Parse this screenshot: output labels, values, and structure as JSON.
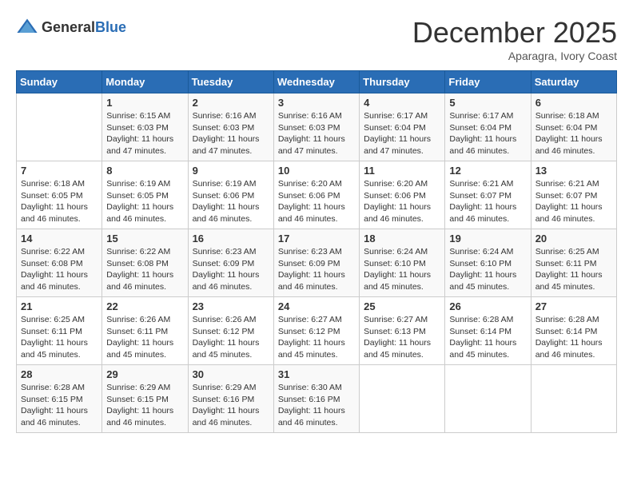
{
  "header": {
    "logo_general": "General",
    "logo_blue": "Blue",
    "title": "December 2025",
    "subtitle": "Aparagra, Ivory Coast"
  },
  "days_of_week": [
    "Sunday",
    "Monday",
    "Tuesday",
    "Wednesday",
    "Thursday",
    "Friday",
    "Saturday"
  ],
  "weeks": [
    [
      {
        "day": "",
        "sunrise": "",
        "sunset": "",
        "daylight": ""
      },
      {
        "day": "1",
        "sunrise": "Sunrise: 6:15 AM",
        "sunset": "Sunset: 6:03 PM",
        "daylight": "Daylight: 11 hours and 47 minutes."
      },
      {
        "day": "2",
        "sunrise": "Sunrise: 6:16 AM",
        "sunset": "Sunset: 6:03 PM",
        "daylight": "Daylight: 11 hours and 47 minutes."
      },
      {
        "day": "3",
        "sunrise": "Sunrise: 6:16 AM",
        "sunset": "Sunset: 6:03 PM",
        "daylight": "Daylight: 11 hours and 47 minutes."
      },
      {
        "day": "4",
        "sunrise": "Sunrise: 6:17 AM",
        "sunset": "Sunset: 6:04 PM",
        "daylight": "Daylight: 11 hours and 47 minutes."
      },
      {
        "day": "5",
        "sunrise": "Sunrise: 6:17 AM",
        "sunset": "Sunset: 6:04 PM",
        "daylight": "Daylight: 11 hours and 46 minutes."
      },
      {
        "day": "6",
        "sunrise": "Sunrise: 6:18 AM",
        "sunset": "Sunset: 6:04 PM",
        "daylight": "Daylight: 11 hours and 46 minutes."
      }
    ],
    [
      {
        "day": "7",
        "sunrise": "Sunrise: 6:18 AM",
        "sunset": "Sunset: 6:05 PM",
        "daylight": "Daylight: 11 hours and 46 minutes."
      },
      {
        "day": "8",
        "sunrise": "Sunrise: 6:19 AM",
        "sunset": "Sunset: 6:05 PM",
        "daylight": "Daylight: 11 hours and 46 minutes."
      },
      {
        "day": "9",
        "sunrise": "Sunrise: 6:19 AM",
        "sunset": "Sunset: 6:06 PM",
        "daylight": "Daylight: 11 hours and 46 minutes."
      },
      {
        "day": "10",
        "sunrise": "Sunrise: 6:20 AM",
        "sunset": "Sunset: 6:06 PM",
        "daylight": "Daylight: 11 hours and 46 minutes."
      },
      {
        "day": "11",
        "sunrise": "Sunrise: 6:20 AM",
        "sunset": "Sunset: 6:06 PM",
        "daylight": "Daylight: 11 hours and 46 minutes."
      },
      {
        "day": "12",
        "sunrise": "Sunrise: 6:21 AM",
        "sunset": "Sunset: 6:07 PM",
        "daylight": "Daylight: 11 hours and 46 minutes."
      },
      {
        "day": "13",
        "sunrise": "Sunrise: 6:21 AM",
        "sunset": "Sunset: 6:07 PM",
        "daylight": "Daylight: 11 hours and 46 minutes."
      }
    ],
    [
      {
        "day": "14",
        "sunrise": "Sunrise: 6:22 AM",
        "sunset": "Sunset: 6:08 PM",
        "daylight": "Daylight: 11 hours and 46 minutes."
      },
      {
        "day": "15",
        "sunrise": "Sunrise: 6:22 AM",
        "sunset": "Sunset: 6:08 PM",
        "daylight": "Daylight: 11 hours and 46 minutes."
      },
      {
        "day": "16",
        "sunrise": "Sunrise: 6:23 AM",
        "sunset": "Sunset: 6:09 PM",
        "daylight": "Daylight: 11 hours and 46 minutes."
      },
      {
        "day": "17",
        "sunrise": "Sunrise: 6:23 AM",
        "sunset": "Sunset: 6:09 PM",
        "daylight": "Daylight: 11 hours and 46 minutes."
      },
      {
        "day": "18",
        "sunrise": "Sunrise: 6:24 AM",
        "sunset": "Sunset: 6:10 PM",
        "daylight": "Daylight: 11 hours and 45 minutes."
      },
      {
        "day": "19",
        "sunrise": "Sunrise: 6:24 AM",
        "sunset": "Sunset: 6:10 PM",
        "daylight": "Daylight: 11 hours and 45 minutes."
      },
      {
        "day": "20",
        "sunrise": "Sunrise: 6:25 AM",
        "sunset": "Sunset: 6:11 PM",
        "daylight": "Daylight: 11 hours and 45 minutes."
      }
    ],
    [
      {
        "day": "21",
        "sunrise": "Sunrise: 6:25 AM",
        "sunset": "Sunset: 6:11 PM",
        "daylight": "Daylight: 11 hours and 45 minutes."
      },
      {
        "day": "22",
        "sunrise": "Sunrise: 6:26 AM",
        "sunset": "Sunset: 6:11 PM",
        "daylight": "Daylight: 11 hours and 45 minutes."
      },
      {
        "day": "23",
        "sunrise": "Sunrise: 6:26 AM",
        "sunset": "Sunset: 6:12 PM",
        "daylight": "Daylight: 11 hours and 45 minutes."
      },
      {
        "day": "24",
        "sunrise": "Sunrise: 6:27 AM",
        "sunset": "Sunset: 6:12 PM",
        "daylight": "Daylight: 11 hours and 45 minutes."
      },
      {
        "day": "25",
        "sunrise": "Sunrise: 6:27 AM",
        "sunset": "Sunset: 6:13 PM",
        "daylight": "Daylight: 11 hours and 45 minutes."
      },
      {
        "day": "26",
        "sunrise": "Sunrise: 6:28 AM",
        "sunset": "Sunset: 6:14 PM",
        "daylight": "Daylight: 11 hours and 45 minutes."
      },
      {
        "day": "27",
        "sunrise": "Sunrise: 6:28 AM",
        "sunset": "Sunset: 6:14 PM",
        "daylight": "Daylight: 11 hours and 46 minutes."
      }
    ],
    [
      {
        "day": "28",
        "sunrise": "Sunrise: 6:28 AM",
        "sunset": "Sunset: 6:15 PM",
        "daylight": "Daylight: 11 hours and 46 minutes."
      },
      {
        "day": "29",
        "sunrise": "Sunrise: 6:29 AM",
        "sunset": "Sunset: 6:15 PM",
        "daylight": "Daylight: 11 hours and 46 minutes."
      },
      {
        "day": "30",
        "sunrise": "Sunrise: 6:29 AM",
        "sunset": "Sunset: 6:16 PM",
        "daylight": "Daylight: 11 hours and 46 minutes."
      },
      {
        "day": "31",
        "sunrise": "Sunrise: 6:30 AM",
        "sunset": "Sunset: 6:16 PM",
        "daylight": "Daylight: 11 hours and 46 minutes."
      },
      {
        "day": "",
        "sunrise": "",
        "sunset": "",
        "daylight": ""
      },
      {
        "day": "",
        "sunrise": "",
        "sunset": "",
        "daylight": ""
      },
      {
        "day": "",
        "sunrise": "",
        "sunset": "",
        "daylight": ""
      }
    ]
  ]
}
